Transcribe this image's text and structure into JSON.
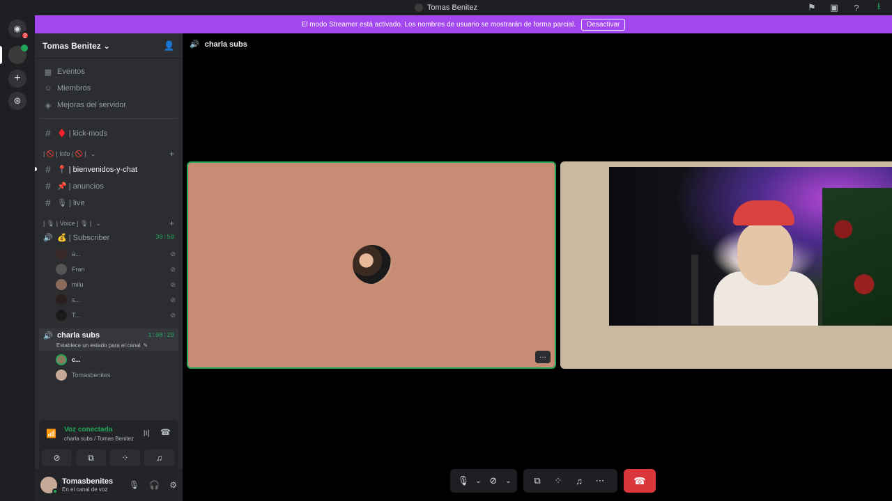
{
  "window": {
    "title": "Tomas Benitez"
  },
  "guilds": {
    "dm_badge": "2"
  },
  "streamer_banner": {
    "message": "El modo Streamer está activado. Los nombres de usuario se mostrarán de forma parcial.",
    "button": "Desactivar"
  },
  "server": {
    "name": "Tomas Benitez",
    "menu": [
      "Eventos",
      "Miembros",
      "Mejoras del servidor"
    ],
    "top_channel": "♦️ | kick-mods",
    "categories": [
      {
        "label": "| 🚫 | Info | 🚫 |",
        "channels": [
          "📍 | bienvenidos-y-chat",
          "📌 | anuncios",
          "🎙 | live"
        ]
      },
      {
        "label": "| 🎙 | Voice | 🎙 |"
      }
    ],
    "voice_channel_1": {
      "name": "💰 | Subscriber",
      "timer": "30:50",
      "users": [
        "a...",
        "Fran",
        "milu",
        "s...",
        "T..."
      ]
    },
    "voice_channel_2": {
      "name": "charla subs",
      "timer": "1:08:29",
      "status_hint": "Establece un estado para el canal",
      "users": [
        "c...",
        "Tomasbenites"
      ]
    }
  },
  "voice_panel": {
    "status": "Voz conectada",
    "location": "charla subs / Tomas Benitez"
  },
  "user": {
    "name": "Tomasbenites",
    "status": "En el canal de voz"
  },
  "call": {
    "channel": "charla subs",
    "more_label": "···"
  },
  "colors": {
    "accent": "#a348f0",
    "connected": "#23a559",
    "hangup": "#da373c"
  }
}
